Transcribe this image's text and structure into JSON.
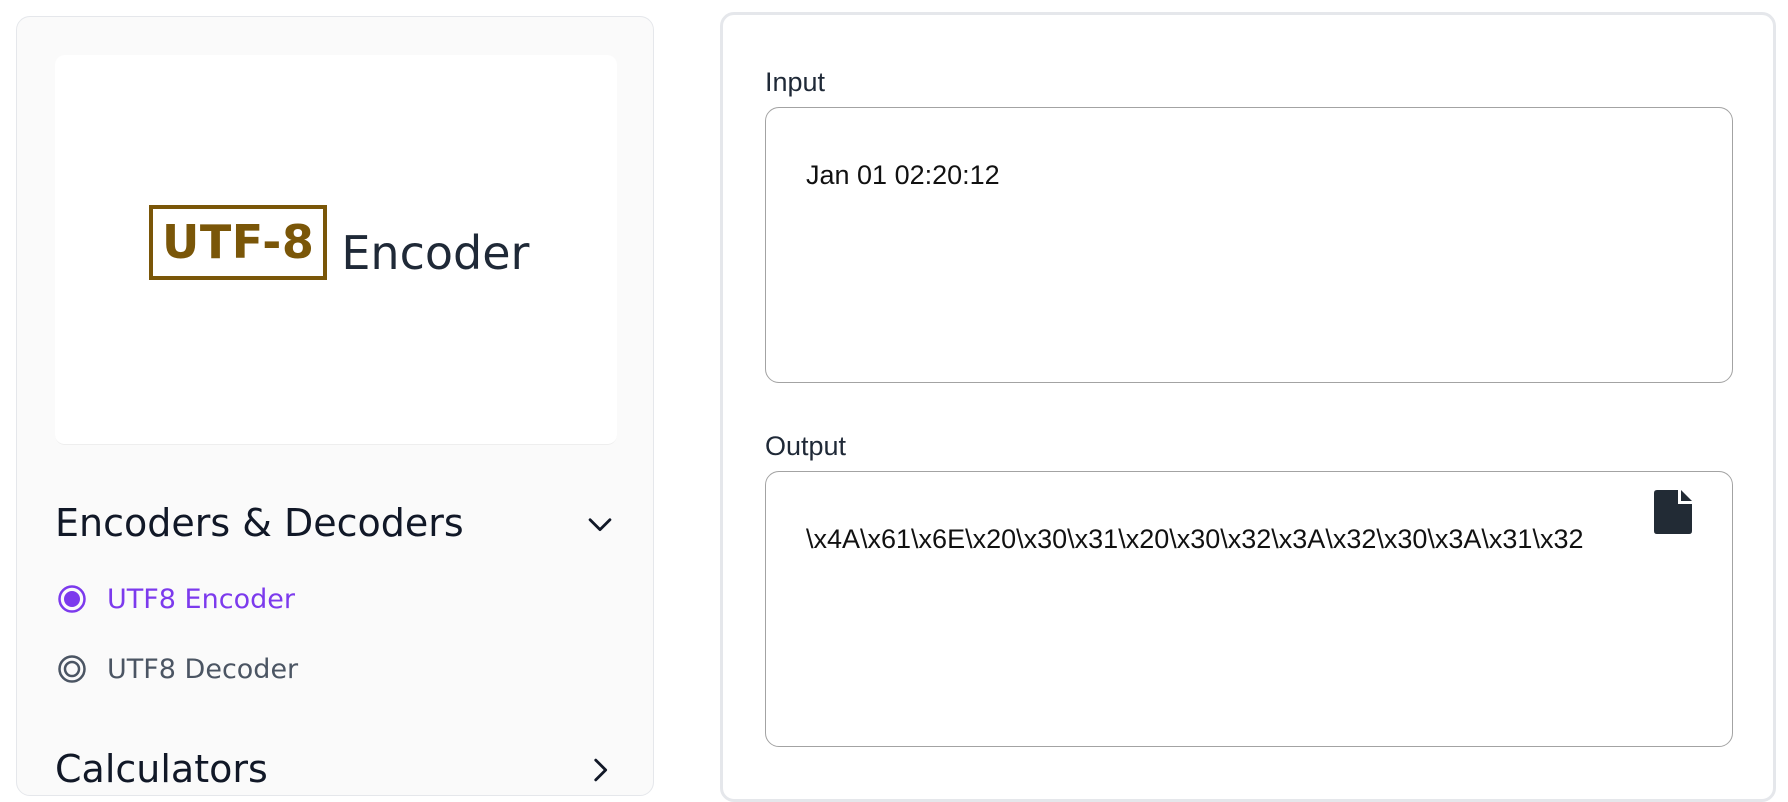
{
  "logo": {
    "badge_text": "UTF-8",
    "word_text": "Encoder",
    "badge_color": "#7a5608"
  },
  "sidebar": {
    "sections": [
      {
        "title": "Encoders & Decoders",
        "expanded": true,
        "items": [
          {
            "label": "UTF8 Encoder",
            "active": true
          },
          {
            "label": "UTF8 Decoder",
            "active": false
          }
        ]
      },
      {
        "title": "Calculators",
        "expanded": false
      }
    ]
  },
  "main": {
    "input": {
      "label": "Input",
      "value": "Jan 01 02:20:12"
    },
    "output": {
      "label": "Output",
      "value": "\\x4A\\x61\\x6E\\x20\\x30\\x31\\x20\\x30\\x32\\x3A\\x32\\x30\\x3A\\x31\\x32",
      "copy_icon": "document-icon"
    }
  },
  "colors": {
    "accent": "#7c3aed",
    "text": "#111827",
    "muted": "#4b5563",
    "border": "#a3a3a3"
  }
}
